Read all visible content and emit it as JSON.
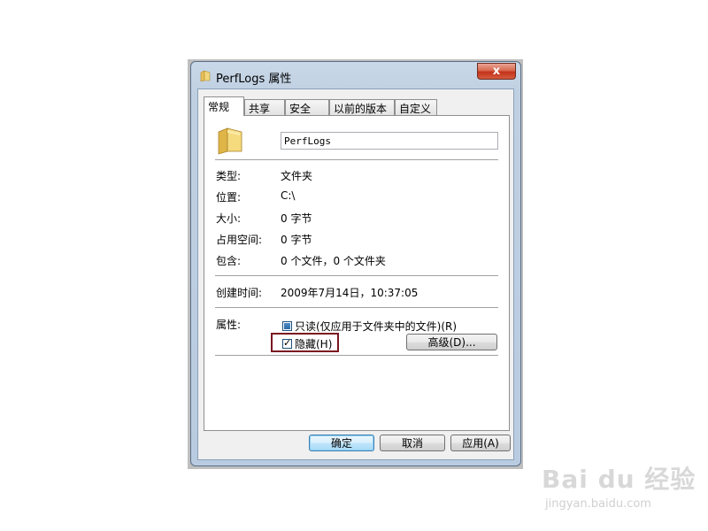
{
  "window": {
    "title": "PerfLogs 属性",
    "close_label": "x"
  },
  "tabs": [
    {
      "label": "常规",
      "active": true
    },
    {
      "label": "共享",
      "active": false
    },
    {
      "label": "安全",
      "active": false
    },
    {
      "label": "以前的版本",
      "active": false
    },
    {
      "label": "自定义",
      "active": false
    }
  ],
  "general": {
    "name_value": "PerfLogs",
    "type": {
      "label": "类型:",
      "value": "文件夹"
    },
    "location": {
      "label": "位置:",
      "value": "C:\\"
    },
    "size": {
      "label": "大小:",
      "value": "0 字节"
    },
    "size_on_disk": {
      "label": "占用空间:",
      "value": "0 字节"
    },
    "contains": {
      "label": "包含:",
      "value": "0 个文件，0 个文件夹"
    },
    "created": {
      "label": "创建时间:",
      "value": "2009年7月14日，10:37:05"
    },
    "attributes": {
      "label": "属性:",
      "readonly": {
        "label": "只读(仅应用于文件夹中的文件)(R)",
        "state": "indeterminate"
      },
      "hidden": {
        "label": "隐藏(H)",
        "state": "checked",
        "mark": "✓"
      },
      "advanced_button": "高级(D)..."
    }
  },
  "buttons": {
    "ok": "确定",
    "cancel": "取消",
    "apply": "应用(A)"
  },
  "watermark": {
    "logo": "Bai du 经验",
    "url": "jingyan.baidu.com"
  },
  "colors": {
    "highlight_box": "#7a1620",
    "folder": "#e8c15a"
  }
}
